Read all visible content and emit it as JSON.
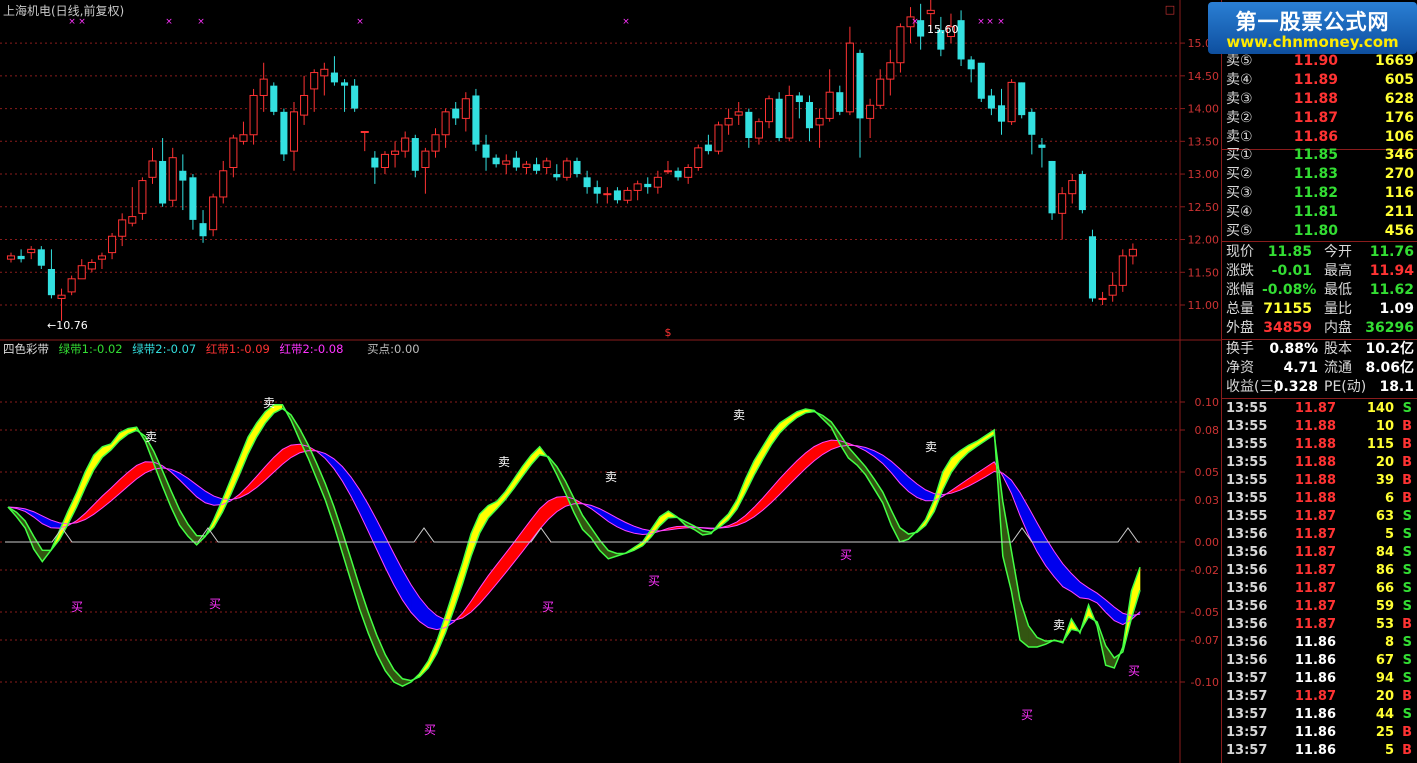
{
  "window": {
    "title": "上海机电(日线,前复权)",
    "marker_box": "□",
    "dollar_marker": "$"
  },
  "price_panel": {
    "annot_high": "15.60",
    "annot_low": "←10.76",
    "y_ticks": [
      "15.00",
      "14.50",
      "14.00",
      "13.50",
      "13.00",
      "12.50",
      "12.00",
      "11.50",
      "11.00"
    ],
    "colors": {
      "up": "#ff3333",
      "down": "#33e0e0",
      "grid": "#8a1c1c",
      "cross": "#ff33ff"
    }
  },
  "indicator": {
    "name": "四色彩带",
    "legends": [
      {
        "text": "绿带1:-0.02",
        "color": "#33dd33"
      },
      {
        "text": "绿带2:-0.07",
        "color": "#33dddd"
      },
      {
        "text": "红带1:-0.09",
        "color": "#ff3333"
      },
      {
        "text": "红带2:-0.08",
        "color": "#ff33ff"
      },
      {
        "text": "买点:0.00",
        "color": "#bbbbbb"
      }
    ],
    "y_ticks": [
      "0.10",
      "0.08",
      "0.05",
      "0.03",
      "0.00",
      "-0.02",
      "-0.05",
      "-0.07",
      "-0.10"
    ],
    "sell_label": "卖",
    "buy_label": "买",
    "colors": {
      "yellow": "#ffff00",
      "olive": "#335511",
      "red": "#ff0000",
      "blue": "#0000ee",
      "greenline": "#44ff44",
      "magline": "#ff44ff"
    }
  },
  "logo": {
    "line1": "第一股票公式网",
    "line2": "www.chnmoney.com"
  },
  "order_book": {
    "asks": [
      {
        "label": "卖⑤",
        "price": "11.90",
        "vol": "1669"
      },
      {
        "label": "卖④",
        "price": "11.89",
        "vol": "605"
      },
      {
        "label": "卖③",
        "price": "11.88",
        "vol": "628"
      },
      {
        "label": "卖②",
        "price": "11.87",
        "vol": "176"
      },
      {
        "label": "卖①",
        "price": "11.86",
        "vol": "106"
      }
    ],
    "bids": [
      {
        "label": "买①",
        "price": "11.85",
        "vol": "346"
      },
      {
        "label": "买②",
        "price": "11.83",
        "vol": "270"
      },
      {
        "label": "买③",
        "price": "11.82",
        "vol": "116"
      },
      {
        "label": "买④",
        "price": "11.81",
        "vol": "211"
      },
      {
        "label": "买⑤",
        "price": "11.80",
        "vol": "456"
      }
    ]
  },
  "quote": [
    {
      "l1": "现价",
      "v1": "11.85",
      "c1": "#33dd33",
      "l2": "今开",
      "v2": "11.76",
      "c2": "#33dd33"
    },
    {
      "l1": "涨跌",
      "v1": "-0.01",
      "c1": "#33dd33",
      "l2": "最高",
      "v2": "11.94",
      "c2": "#ff3333"
    },
    {
      "l1": "涨幅",
      "v1": "-0.08%",
      "c1": "#33dd33",
      "l2": "最低",
      "v2": "11.62",
      "c2": "#33dd33"
    },
    {
      "l1": "总量",
      "v1": "71155",
      "c1": "#ffff33",
      "l2": "量比",
      "v2": "1.09",
      "c2": "#ffffff"
    },
    {
      "l1": "外盘",
      "v1": "34859",
      "c1": "#ff3333",
      "l2": "内盘",
      "v2": "36296",
      "c2": "#33dd33"
    }
  ],
  "stats": [
    {
      "l1": "换手",
      "v1": "0.88%",
      "l2": "股本",
      "v2": "10.2亿"
    },
    {
      "l1": "净资",
      "v1": "4.71",
      "l2": "流通",
      "v2": "8.06亿"
    },
    {
      "l1": "收益(三)",
      "v1": "0.328",
      "l2": "PE(动)",
      "v2": "18.1"
    }
  ],
  "ticks": [
    {
      "t": "13:55",
      "p": "11.87",
      "pc": "#ff3333",
      "v": "140",
      "f": "S"
    },
    {
      "t": "13:55",
      "p": "11.88",
      "pc": "#ff3333",
      "v": "10",
      "f": "B"
    },
    {
      "t": "13:55",
      "p": "11.88",
      "pc": "#ff3333",
      "v": "115",
      "f": "B"
    },
    {
      "t": "13:55",
      "p": "11.88",
      "pc": "#ff3333",
      "v": "20",
      "f": "B"
    },
    {
      "t": "13:55",
      "p": "11.88",
      "pc": "#ff3333",
      "v": "39",
      "f": "B"
    },
    {
      "t": "13:55",
      "p": "11.88",
      "pc": "#ff3333",
      "v": "6",
      "f": "B"
    },
    {
      "t": "13:55",
      "p": "11.87",
      "pc": "#ff3333",
      "v": "63",
      "f": "S"
    },
    {
      "t": "13:56",
      "p": "11.87",
      "pc": "#ff3333",
      "v": "5",
      "f": "S"
    },
    {
      "t": "13:56",
      "p": "11.87",
      "pc": "#ff3333",
      "v": "84",
      "f": "S"
    },
    {
      "t": "13:56",
      "p": "11.87",
      "pc": "#ff3333",
      "v": "86",
      "f": "S"
    },
    {
      "t": "13:56",
      "p": "11.87",
      "pc": "#ff3333",
      "v": "66",
      "f": "S"
    },
    {
      "t": "13:56",
      "p": "11.87",
      "pc": "#ff3333",
      "v": "59",
      "f": "S"
    },
    {
      "t": "13:56",
      "p": "11.87",
      "pc": "#ff3333",
      "v": "53",
      "f": "B"
    },
    {
      "t": "13:56",
      "p": "11.86",
      "pc": "#ffffff",
      "v": "8",
      "f": "S"
    },
    {
      "t": "13:56",
      "p": "11.86",
      "pc": "#ffffff",
      "v": "67",
      "f": "S"
    },
    {
      "t": "13:57",
      "p": "11.86",
      "pc": "#ffffff",
      "v": "94",
      "f": "S"
    },
    {
      "t": "13:57",
      "p": "11.87",
      "pc": "#ff3333",
      "v": "20",
      "f": "B"
    },
    {
      "t": "13:57",
      "p": "11.86",
      "pc": "#ffffff",
      "v": "44",
      "f": "S"
    },
    {
      "t": "13:57",
      "p": "11.86",
      "pc": "#ffffff",
      "v": "25",
      "f": "B"
    },
    {
      "t": "13:57",
      "p": "11.86",
      "pc": "#ffffff",
      "v": "5",
      "f": "B"
    }
  ],
  "chart_data": {
    "type": "candlestick",
    "title": "上海机电(日线,前复权)",
    "ohlc": [
      [
        11.7,
        11.8,
        11.65,
        11.75
      ],
      [
        11.75,
        11.85,
        11.65,
        11.7
      ],
      [
        11.8,
        11.9,
        11.7,
        11.85
      ],
      [
        11.85,
        11.9,
        11.55,
        11.6
      ],
      [
        11.55,
        11.85,
        11.1,
        11.15
      ],
      [
        11.1,
        11.25,
        10.76,
        11.15
      ],
      [
        11.2,
        11.45,
        11.15,
        11.4
      ],
      [
        11.4,
        11.7,
        11.4,
        11.6
      ],
      [
        11.55,
        11.7,
        11.5,
        11.65
      ],
      [
        11.7,
        11.8,
        11.55,
        11.75
      ],
      [
        11.8,
        12.1,
        11.7,
        12.05
      ],
      [
        12.05,
        12.4,
        11.9,
        12.3
      ],
      [
        12.25,
        12.8,
        12.2,
        12.35
      ],
      [
        12.4,
        12.95,
        12.3,
        12.9
      ],
      [
        12.95,
        13.4,
        12.85,
        13.2
      ],
      [
        13.2,
        13.55,
        12.5,
        12.55
      ],
      [
        12.6,
        13.4,
        12.5,
        13.25
      ],
      [
        13.05,
        13.3,
        12.45,
        12.9
      ],
      [
        12.95,
        13.0,
        12.15,
        12.3
      ],
      [
        12.25,
        12.45,
        11.95,
        12.05
      ],
      [
        12.15,
        12.7,
        12.05,
        12.65
      ],
      [
        12.65,
        13.2,
        12.55,
        13.05
      ],
      [
        13.1,
        13.6,
        12.95,
        13.55
      ],
      [
        13.5,
        13.8,
        13.45,
        13.6
      ],
      [
        13.6,
        14.3,
        13.45,
        14.2
      ],
      [
        14.2,
        14.7,
        13.95,
        14.45
      ],
      [
        14.35,
        14.4,
        13.9,
        13.95
      ],
      [
        13.95,
        14.0,
        13.2,
        13.3
      ],
      [
        13.35,
        14.1,
        13.05,
        13.95
      ],
      [
        13.9,
        14.5,
        13.75,
        14.2
      ],
      [
        14.3,
        14.6,
        13.95,
        14.55
      ],
      [
        14.5,
        14.7,
        14.2,
        14.6
      ],
      [
        14.55,
        14.8,
        14.35,
        14.4
      ],
      [
        14.4,
        14.45,
        13.95,
        14.35
      ],
      [
        14.35,
        14.45,
        13.95,
        14.0
      ],
      [
        13.65,
        13.65,
        13.35,
        13.65
      ],
      [
        13.25,
        13.35,
        12.85,
        13.1
      ],
      [
        13.1,
        13.35,
        13.0,
        13.3
      ],
      [
        13.3,
        13.5,
        13.1,
        13.35
      ],
      [
        13.35,
        13.65,
        13.25,
        13.55
      ],
      [
        13.55,
        13.6,
        12.95,
        13.05
      ],
      [
        13.1,
        13.4,
        12.7,
        13.35
      ],
      [
        13.35,
        13.7,
        13.25,
        13.6
      ],
      [
        13.6,
        14.0,
        13.4,
        13.95
      ],
      [
        14.0,
        14.1,
        13.75,
        13.85
      ],
      [
        13.85,
        14.25,
        13.65,
        14.15
      ],
      [
        14.2,
        14.3,
        13.35,
        13.45
      ],
      [
        13.45,
        13.6,
        13.05,
        13.25
      ],
      [
        13.25,
        13.3,
        13.1,
        13.15
      ],
      [
        13.15,
        13.3,
        13.0,
        13.2
      ],
      [
        13.25,
        13.35,
        13.05,
        13.1
      ],
      [
        13.1,
        13.2,
        13.0,
        13.15
      ],
      [
        13.15,
        13.25,
        13.0,
        13.05
      ],
      [
        13.1,
        13.25,
        13.0,
        13.2
      ],
      [
        13.0,
        13.15,
        12.9,
        12.95
      ],
      [
        12.95,
        13.25,
        12.9,
        13.2
      ],
      [
        13.2,
        13.25,
        12.95,
        13.0
      ],
      [
        12.95,
        13.05,
        12.7,
        12.8
      ],
      [
        12.8,
        12.9,
        12.55,
        12.7
      ],
      [
        12.7,
        12.8,
        12.55,
        12.7
      ],
      [
        12.75,
        12.8,
        12.55,
        12.6
      ],
      [
        12.6,
        12.8,
        12.55,
        12.75
      ],
      [
        12.75,
        12.9,
        12.6,
        12.85
      ],
      [
        12.85,
        12.95,
        12.7,
        12.8
      ],
      [
        12.8,
        13.05,
        12.7,
        12.95
      ],
      [
        13.05,
        13.2,
        13.0,
        13.05
      ],
      [
        13.05,
        13.1,
        12.9,
        12.95
      ],
      [
        12.95,
        13.15,
        12.85,
        13.1
      ],
      [
        13.1,
        13.45,
        13.05,
        13.4
      ],
      [
        13.45,
        13.6,
        13.3,
        13.35
      ],
      [
        13.35,
        13.8,
        13.3,
        13.75
      ],
      [
        13.75,
        14.0,
        13.6,
        13.85
      ],
      [
        13.9,
        14.1,
        13.75,
        13.95
      ],
      [
        13.95,
        14.0,
        13.4,
        13.55
      ],
      [
        13.55,
        13.85,
        13.45,
        13.8
      ],
      [
        13.8,
        14.2,
        13.7,
        14.15
      ],
      [
        14.15,
        14.25,
        13.5,
        13.55
      ],
      [
        13.55,
        14.35,
        13.5,
        14.2
      ],
      [
        14.2,
        14.25,
        13.85,
        14.1
      ],
      [
        14.1,
        14.2,
        13.5,
        13.7
      ],
      [
        13.75,
        14.0,
        13.4,
        13.85
      ],
      [
        13.85,
        14.6,
        13.8,
        14.25
      ],
      [
        14.25,
        14.35,
        13.9,
        13.95
      ],
      [
        13.95,
        15.25,
        13.9,
        15.0
      ],
      [
        14.85,
        14.9,
        13.25,
        13.85
      ],
      [
        13.85,
        14.15,
        13.55,
        14.05
      ],
      [
        14.05,
        14.6,
        14.0,
        14.45
      ],
      [
        14.45,
        14.9,
        14.2,
        14.7
      ],
      [
        14.7,
        15.3,
        14.55,
        15.25
      ],
      [
        15.25,
        15.55,
        15.0,
        15.4
      ],
      [
        15.35,
        15.6,
        14.9,
        15.1
      ],
      [
        15.45,
        15.7,
        15.2,
        15.5
      ],
      [
        15.2,
        15.4,
        14.8,
        14.9
      ],
      [
        15.1,
        15.45,
        15.0,
        15.25
      ],
      [
        15.35,
        15.5,
        14.65,
        14.75
      ],
      [
        14.75,
        14.8,
        14.4,
        14.6
      ],
      [
        14.7,
        14.7,
        14.1,
        14.15
      ],
      [
        14.2,
        14.3,
        13.9,
        14.0
      ],
      [
        14.05,
        14.3,
        13.6,
        13.8
      ],
      [
        13.8,
        14.45,
        13.75,
        14.4
      ],
      [
        14.4,
        14.4,
        13.85,
        13.9
      ],
      [
        13.95,
        14.0,
        13.3,
        13.6
      ],
      [
        13.45,
        13.55,
        13.1,
        13.4
      ],
      [
        13.2,
        13.2,
        12.3,
        12.4
      ],
      [
        12.4,
        12.8,
        12.0,
        12.7
      ],
      [
        12.7,
        13.0,
        12.55,
        12.9
      ],
      [
        13.0,
        13.05,
        12.4,
        12.45
      ],
      [
        12.05,
        12.15,
        11.05,
        11.1
      ],
      [
        11.1,
        11.2,
        11.0,
        11.1
      ],
      [
        11.15,
        11.5,
        11.05,
        11.3
      ],
      [
        11.3,
        11.85,
        11.2,
        11.75
      ],
      [
        11.75,
        11.94,
        11.62,
        11.85
      ]
    ],
    "indicator": {
      "name": "四色彩带",
      "series": [
        {
          "name": "绿带1",
          "color": "#33dd33",
          "last": -0.02
        },
        {
          "name": "绿带2",
          "color": "#33dddd",
          "last": -0.07
        },
        {
          "name": "红带1",
          "color": "#ff3333",
          "last": -0.09
        },
        {
          "name": "红带2",
          "color": "#ff33ff",
          "last": -0.08
        }
      ],
      "buy_point": 0.0,
      "ylim": [
        -0.125,
        0.125
      ],
      "fast": [
        0.025,
        0.018,
        0.01,
        -0.005,
        -0.014,
        -0.006,
        0.008,
        0.022,
        0.035,
        0.05,
        0.062,
        0.068,
        0.07,
        0.078,
        0.081,
        0.082,
        0.072,
        0.056,
        0.04,
        0.025,
        0.012,
        0.004,
        -0.002,
        0.004,
        0.016,
        0.03,
        0.045,
        0.06,
        0.075,
        0.085,
        0.093,
        0.098,
        0.098,
        0.087,
        0.073,
        0.06,
        0.045,
        0.03,
        0.012,
        -0.008,
        -0.028,
        -0.048,
        -0.065,
        -0.08,
        -0.092,
        -0.1,
        -0.103,
        -0.1,
        -0.094,
        -0.085,
        -0.071,
        -0.053,
        -0.034,
        -0.015,
        0.006,
        0.02,
        0.026,
        0.029,
        0.036,
        0.045,
        0.054,
        0.062,
        0.068,
        0.06,
        0.048,
        0.035,
        0.021,
        0.009,
        0.003,
        -0.006,
        -0.012,
        -0.01,
        -0.008,
        -0.004,
        0.0,
        0.009,
        0.018,
        0.022,
        0.018,
        0.012,
        0.009,
        0.005,
        0.006,
        0.014,
        0.02,
        0.03,
        0.045,
        0.058,
        0.068,
        0.078,
        0.085,
        0.089,
        0.093,
        0.095,
        0.094,
        0.088,
        0.082,
        0.07,
        0.06,
        0.055,
        0.048,
        0.038,
        0.028,
        0.012,
        0.0,
        0.002,
        0.008,
        0.016,
        0.03,
        0.05,
        0.06,
        0.065,
        0.069,
        0.072,
        0.076,
        0.08,
        -0.01,
        -0.035,
        -0.07,
        -0.075,
        -0.075,
        -0.073,
        -0.07,
        -0.072,
        -0.055,
        -0.065,
        -0.045,
        -0.06,
        -0.088,
        -0.09,
        -0.075,
        -0.035,
        -0.018
      ]
    }
  }
}
